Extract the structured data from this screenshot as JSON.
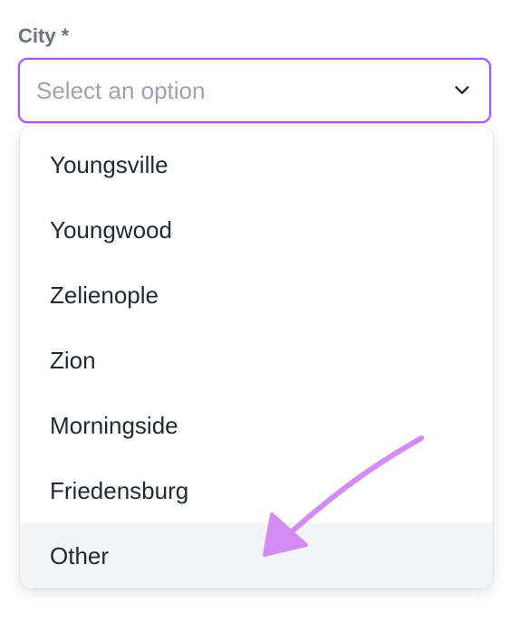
{
  "field": {
    "label": "City",
    "required_mark": "*",
    "placeholder": "Select an option"
  },
  "dropdown": {
    "options": [
      {
        "label": "Youngsville"
      },
      {
        "label": "Youngwood"
      },
      {
        "label": "Zelienople"
      },
      {
        "label": "Zion"
      },
      {
        "label": "Morningside"
      },
      {
        "label": "Friedensburg"
      },
      {
        "label": "Other"
      }
    ],
    "highlighted_index": 6
  },
  "colors": {
    "accent": "#a855f7",
    "label": "#6b7280",
    "placeholder": "#9ca3af",
    "option_text": "#1f2937",
    "highlight_bg": "#f3f4f6",
    "annotation_arrow": "#d48cf5"
  },
  "annotation": {
    "icon": "arrow-icon",
    "points_to": "Other"
  }
}
